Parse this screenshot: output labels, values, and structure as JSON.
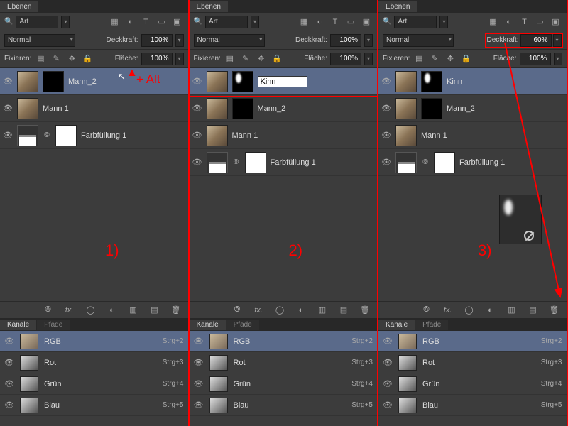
{
  "panels": [
    {
      "title": "Ebenen",
      "searchPlaceholder": "Art",
      "blendMode": "Normal",
      "opacityLabel": "Deckkraft:",
      "opacityValue": "100%",
      "lockLabel": "Fixieren:",
      "fillLabel": "Fläche:",
      "fillValue": "100%",
      "stepLabel": "1)",
      "hint": "+ Alt",
      "layers": [
        {
          "name": "Mann_2",
          "selected": true,
          "thumbs": [
            "photo",
            "mask-black"
          ]
        },
        {
          "name": "Mann 1",
          "selected": false,
          "thumbs": [
            "photo"
          ]
        },
        {
          "name": "Farbfüllung 1",
          "selected": false,
          "thumbs": [
            "adjust-icon",
            "mask-white"
          ],
          "link": true
        }
      ]
    },
    {
      "title": "Ebenen",
      "searchPlaceholder": "Art",
      "blendMode": "Normal",
      "opacityLabel": "Deckkraft:",
      "opacityValue": "100%",
      "lockLabel": "Fixieren:",
      "fillLabel": "Fläche:",
      "fillValue": "100%",
      "stepLabel": "2)",
      "renameValue": "Kinn",
      "layers": [
        {
          "name": "Kinn",
          "selected": true,
          "editing": true,
          "thumbs": [
            "photo",
            "mask-spot"
          ],
          "redbox": true
        },
        {
          "name": "Mann_2",
          "selected": false,
          "thumbs": [
            "photo",
            "mask-black"
          ]
        },
        {
          "name": "Mann 1",
          "selected": false,
          "thumbs": [
            "photo"
          ]
        },
        {
          "name": "Farbfüllung 1",
          "selected": false,
          "thumbs": [
            "adjust-icon",
            "mask-white"
          ],
          "link": true
        }
      ]
    },
    {
      "title": "Ebenen",
      "searchPlaceholder": "Art",
      "blendMode": "Normal",
      "opacityLabel": "Deckkraft:",
      "opacityValue": "60%",
      "opacityHighlight": true,
      "lockLabel": "Fixieren:",
      "fillLabel": "Fläche:",
      "fillValue": "100%",
      "stepLabel": "3)",
      "layers": [
        {
          "name": "Kinn",
          "selected": true,
          "thumbs": [
            "photo",
            "mask-spot"
          ]
        },
        {
          "name": "Mann_2",
          "selected": false,
          "thumbs": [
            "photo",
            "mask-black"
          ]
        },
        {
          "name": "Mann 1",
          "selected": false,
          "thumbs": [
            "photo"
          ]
        },
        {
          "name": "Farbfüllung 1",
          "selected": false,
          "thumbs": [
            "adjust-icon",
            "mask-white"
          ],
          "link": true
        }
      ]
    }
  ],
  "channelsTitle": "Kanäle",
  "pathsTitle": "Pfade",
  "channels": [
    {
      "name": "RGB",
      "short": "Strg+2",
      "selected": true,
      "thumb": "color"
    },
    {
      "name": "Rot",
      "short": "Strg+3",
      "selected": false,
      "thumb": "bw"
    },
    {
      "name": "Grün",
      "short": "Strg+4",
      "selected": false,
      "thumb": "bw"
    },
    {
      "name": "Blau",
      "short": "Strg+5",
      "selected": false,
      "thumb": "bw"
    }
  ],
  "icons": {
    "image": "▦",
    "adjust": "◐",
    "type": "T",
    "shape": "▭",
    "smart": "▣",
    "lock": "🔒",
    "brush": "✎",
    "move": "✥",
    "fillLock": "▤",
    "link": "⦾",
    "fx": "fx.",
    "mask": "◯",
    "newfill": "◐",
    "group": "▮",
    "new": "▤",
    "trash": "🗑"
  }
}
